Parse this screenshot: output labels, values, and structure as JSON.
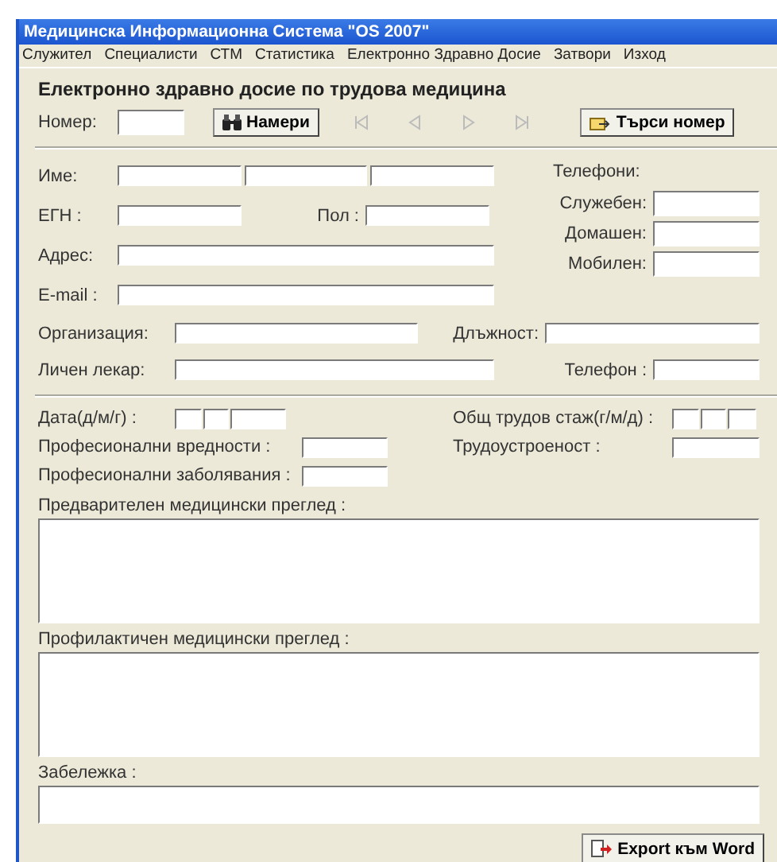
{
  "window": {
    "title": "Медицинска Информационна Система \"OS 2007\""
  },
  "menu": [
    "Служител",
    "Специалисти",
    "СТМ",
    "Статистика",
    "Електронно Здравно Досие",
    "Затвори",
    "Изход"
  ],
  "form": {
    "heading": "Електронно здравно досие по трудова медицина",
    "number": {
      "label": "Номер:"
    },
    "find_button": "Намери",
    "navigation": [
      {
        "kind": "first",
        "disabled": true
      },
      {
        "kind": "previous",
        "disabled": true
      },
      {
        "kind": "next",
        "disabled": true
      },
      {
        "kind": "last",
        "disabled": true
      }
    ],
    "search_button": "Търси номер",
    "name": {
      "label": "Име:"
    },
    "phones": {
      "label": "Телефони:",
      "items": [
        {
          "label": "Служебен:"
        },
        {
          "label": "Домашен:"
        },
        {
          "label": "Мобилен:"
        }
      ]
    },
    "egn": {
      "label": "ЕГН :"
    },
    "gender": {
      "label": "Пол :"
    },
    "address": {
      "label": "Адрес:"
    },
    "email": {
      "label": "E-mail :"
    },
    "organization": {
      "label": "Организация:"
    },
    "position": {
      "label": "Длъжност:"
    },
    "doctor": {
      "label": "Личен лекар:"
    },
    "doctor_phone": {
      "label": "Телефон :"
    },
    "date": {
      "label": "Дата(д/м/г) :"
    },
    "experience": {
      "label": "Общ трудов стаж(г/м/д) :"
    },
    "hazards": {
      "label": "Професионални вредности :"
    },
    "employment": {
      "label": "Трудоустроеност :"
    },
    "diseases": {
      "label": "Професионални заболявания :"
    },
    "preliminary": {
      "label": "Предварителен медицински преглед :"
    },
    "prophylactic": {
      "label": "Профилактичен медицински преглед :"
    },
    "note": {
      "label": "Забележка :"
    },
    "export_button": "Export към Word"
  }
}
